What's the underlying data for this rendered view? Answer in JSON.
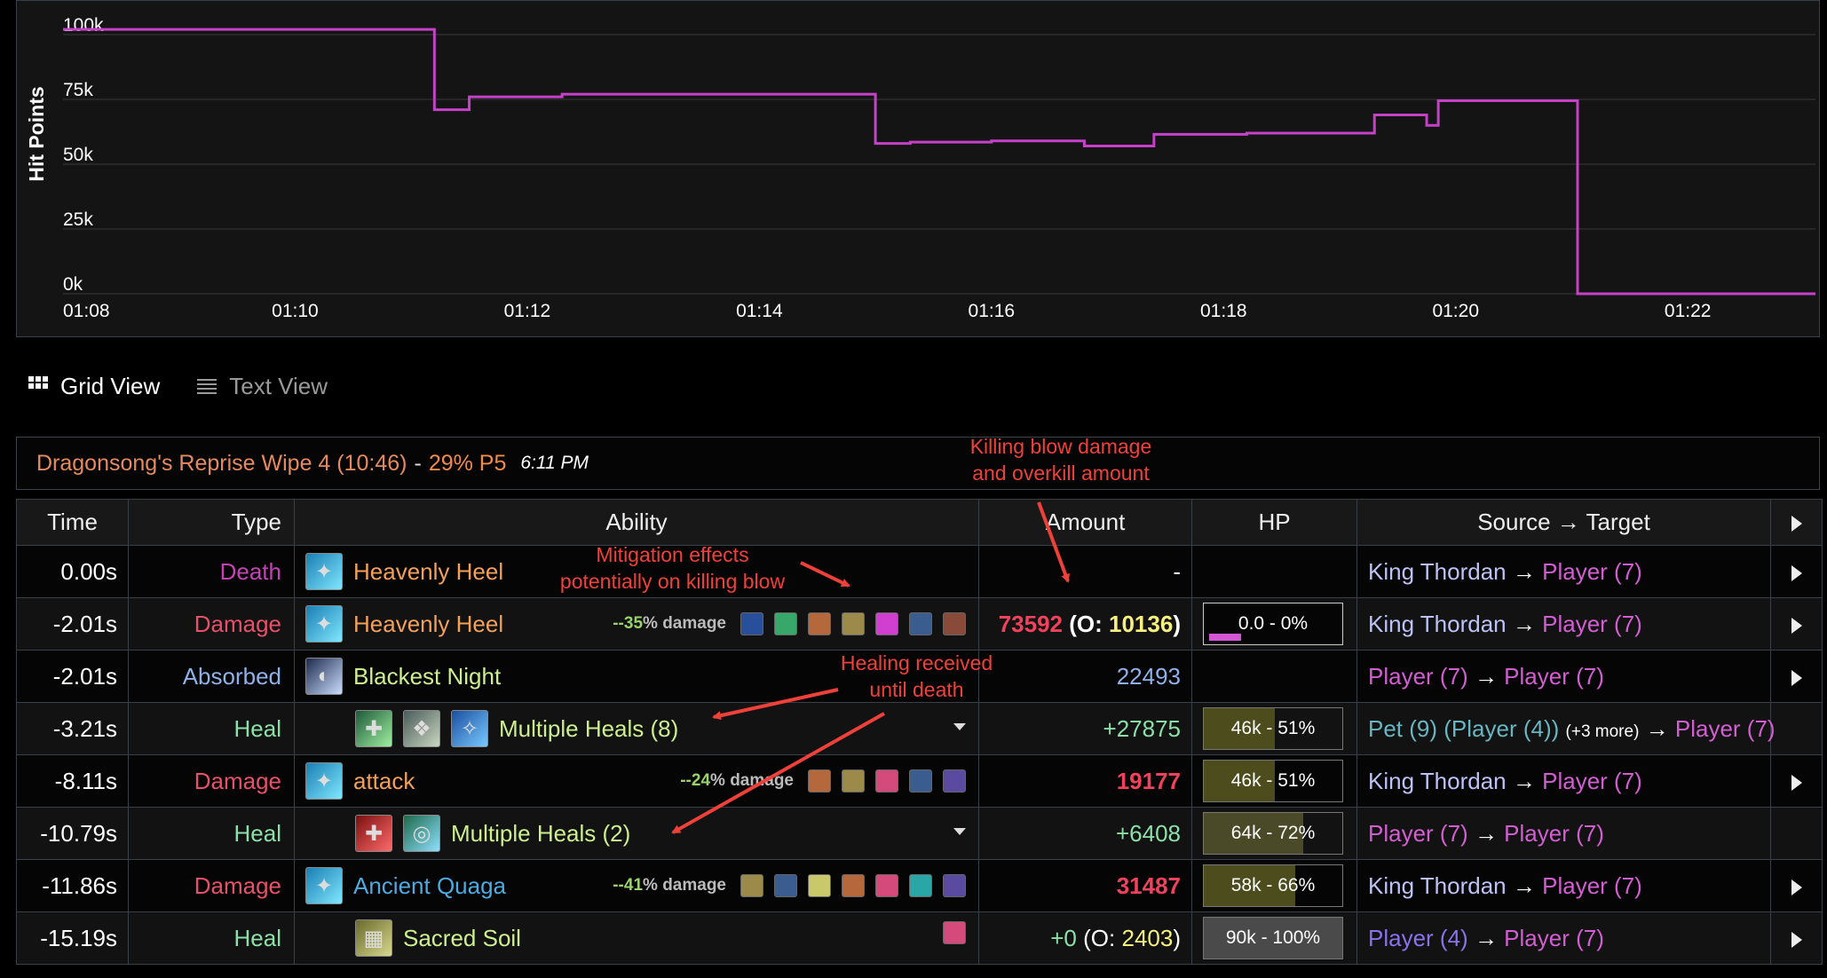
{
  "chart_data": {
    "type": "line",
    "ylabel": "Hit Points",
    "y_ticks": [
      "100k",
      "75k",
      "50k",
      "25k",
      "0k"
    ],
    "y_tick_values": [
      100000,
      75000,
      50000,
      25000,
      0
    ],
    "x_ticks": [
      "01:08",
      "01:10",
      "01:12",
      "01:14",
      "01:16",
      "01:18",
      "01:20",
      "01:22"
    ],
    "x_tick_values": [
      68,
      70,
      72,
      74,
      76,
      78,
      80,
      82
    ],
    "xlim": [
      68,
      83.1
    ],
    "ylim": [
      0,
      100000
    ],
    "grid": true,
    "step": true,
    "color": "#c542c8",
    "series": [
      {
        "x": [
          68.0,
          71.2,
          71.5,
          72.3,
          75.0,
          75.3,
          76.0,
          76.8,
          77.4,
          78.2,
          79.3,
          79.75,
          79.85,
          81.05,
          83.1
        ],
        "y": [
          102000,
          71000,
          76000,
          77000,
          58000,
          58500,
          59000,
          57000,
          61500,
          62000,
          69000,
          65000,
          74500,
          0,
          0
        ]
      }
    ]
  },
  "tabs": {
    "grid_view": "Grid View",
    "text_view": "Text View"
  },
  "header": {
    "encounter": "Dragonsong's Reprise Wipe 4 (10:46)",
    "sep": "-",
    "pct": "29% P5",
    "time": "6:11 PM"
  },
  "annotations": {
    "killing_blow": "Killing blow damage\nand overkill amount",
    "mitigation": "Mitigation effects\npotentially on killing blow",
    "healing": "Healing received\nuntil death"
  },
  "columns": {
    "time": "Time",
    "type": "Type",
    "ability": "Ability",
    "amount": "Amount",
    "hp": "HP",
    "source_target": "Source → Target"
  },
  "rows": [
    {
      "time": "0.00s",
      "type": "Death",
      "ability": "Heavenly Heel",
      "amount": "-",
      "source": "King Thordan",
      "arrow": "→",
      "target": "Player (7)",
      "hp_fraction": null
    },
    {
      "time": "-2.01s",
      "type": "Damage",
      "ability": "Heavenly Heel",
      "mit_pct": "--35",
      "mit_label": "% damage",
      "amount": "73592",
      "ok_open": "(O: ",
      "overkill": "10136",
      "ok_close": ")",
      "hp": "0.0 - 0%",
      "hp_fraction": 0.0,
      "source": "King Thordan",
      "arrow": "→",
      "target": "Player (7)"
    },
    {
      "time": "-2.01s",
      "type": "Absorbed",
      "ability": "Blackest Night",
      "amount": "22493",
      "source": "Player (7)",
      "arrow": "→",
      "target": "Player (7)"
    },
    {
      "time": "-3.21s",
      "type": "Heal",
      "ability": "Multiple Heals (8)",
      "amount": "+27875",
      "hp": "46k - 51%",
      "hp_fraction": 0.51,
      "source_pet": "Pet (9)",
      "source_owner": "(Player (4))",
      "source_more": "(+3 more)",
      "arrow": "→",
      "target": "Player (7)"
    },
    {
      "time": "-8.11s",
      "type": "Damage",
      "ability": "attack",
      "mit_pct": "--24",
      "mit_label": "% damage",
      "amount": "19177",
      "hp": "46k - 51%",
      "hp_fraction": 0.51,
      "source": "King Thordan",
      "arrow": "→",
      "target": "Player (7)"
    },
    {
      "time": "-10.79s",
      "type": "Heal",
      "ability": "Multiple Heals (2)",
      "amount": "+6408",
      "hp": "64k - 72%",
      "hp_fraction": 0.72,
      "source": "Player (7)",
      "arrow": "→",
      "target": "Player (7)"
    },
    {
      "time": "-11.86s",
      "type": "Damage",
      "ability": "Ancient Quaga",
      "mit_pct": "--41",
      "mit_label": "% damage",
      "amount": "31487",
      "hp": "58k - 66%",
      "hp_fraction": 0.66,
      "source": "King Thordan",
      "arrow": "→",
      "target": "Player (7)"
    },
    {
      "time": "-15.19s",
      "type": "Heal",
      "ability": "Sacred Soil",
      "amount": "+0",
      "ok_open": "(O: ",
      "overkill": "2403",
      "ok_close": ")",
      "hp": "90k - 100%",
      "hp_fraction": 1.0,
      "source": "Player (4)",
      "arrow": "→",
      "target": "Player (7)"
    }
  ],
  "colors": {
    "line": "#c542c8",
    "damage": "#e8506a",
    "heal": "#8be0a8",
    "absorbed": "#8fb1ea",
    "death": "#c542b5",
    "annotation": "#f0403a",
    "hp_fill": "#4c4c1c"
  }
}
